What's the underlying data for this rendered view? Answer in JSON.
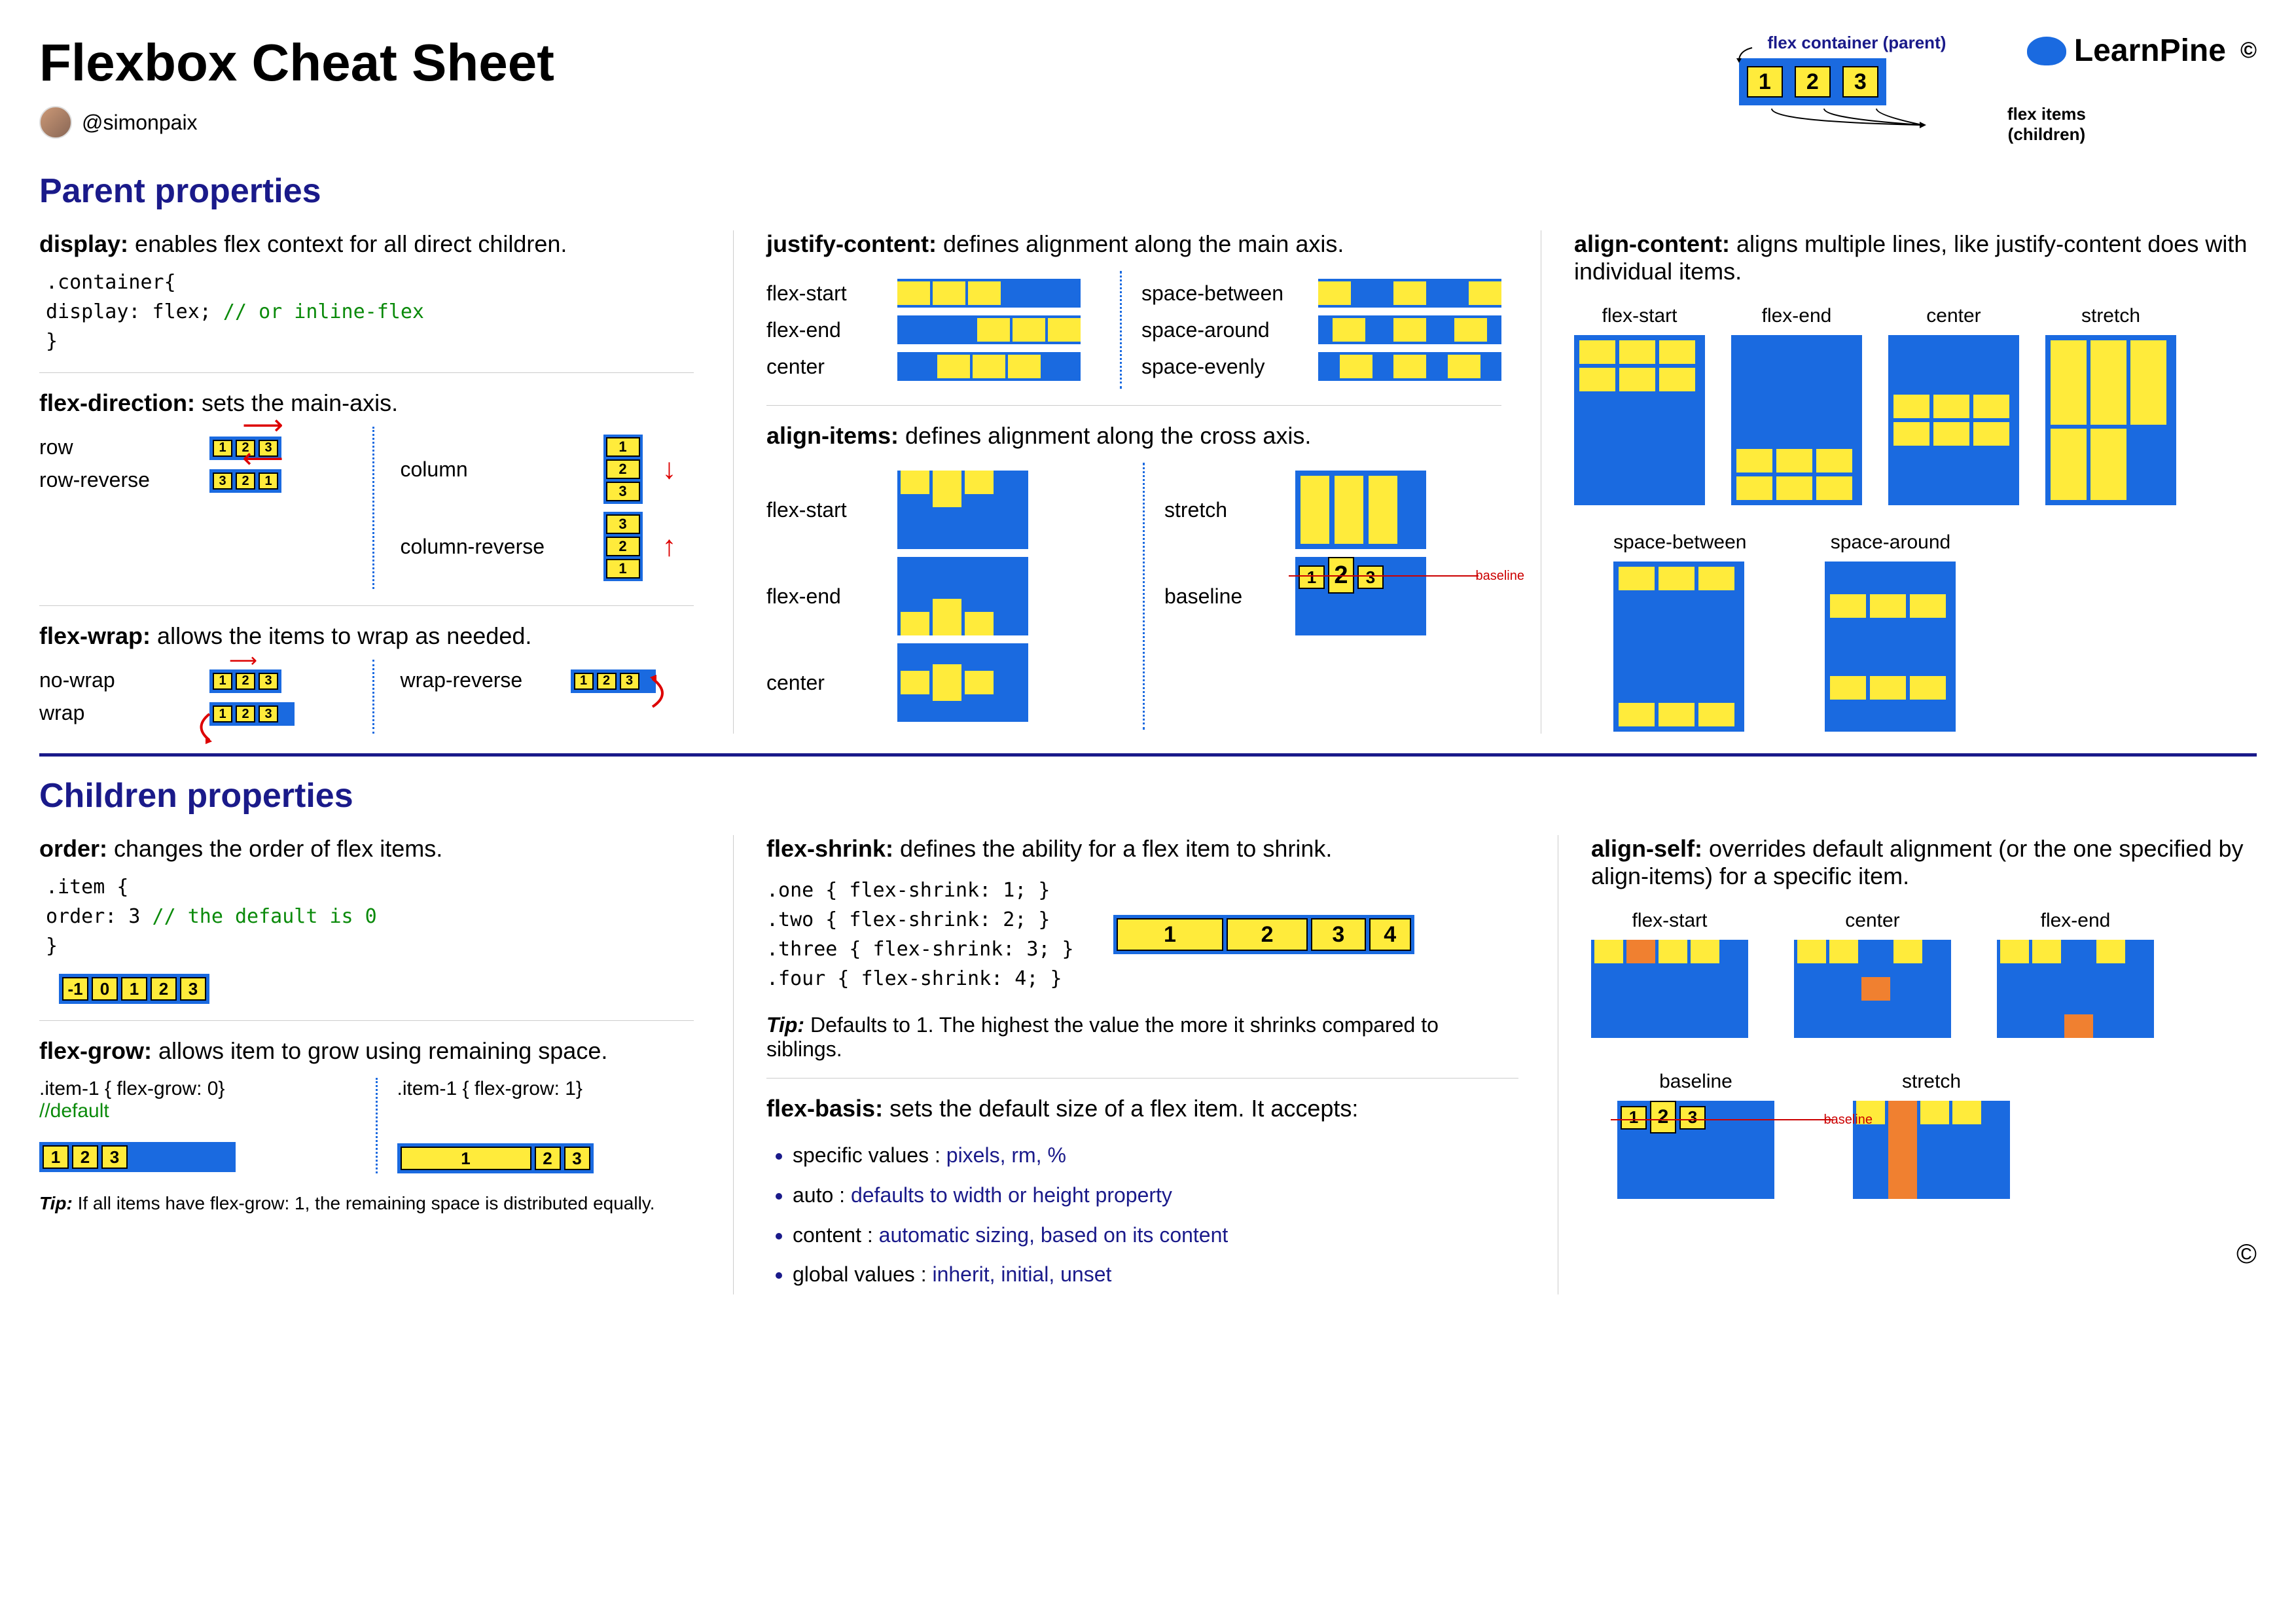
{
  "title": "Flexbox Cheat Sheet",
  "author_handle": "@simonpaix",
  "brand": "LearnPine",
  "copyright": "©",
  "legend": {
    "container_label": "flex container (parent)",
    "items_label_1": "flex items",
    "items_label_2": "(children)",
    "items": [
      "1",
      "2",
      "3"
    ]
  },
  "section_parent": "Parent properties",
  "section_children": "Children properties",
  "display": {
    "name": "display:",
    "desc": " enables flex context for all direct children.",
    "code_open": ".container{",
    "code_prop": "  display: flex;",
    "code_comment": "  // or inline-flex",
    "code_close": "}"
  },
  "flex_direction": {
    "name": "flex-direction:",
    "desc": " sets the main-axis.",
    "row": "row",
    "row_reverse": "row-reverse",
    "column": "column",
    "column_reverse": "column-reverse"
  },
  "flex_wrap": {
    "name": "flex-wrap:",
    "desc": " allows the items to wrap as needed.",
    "no_wrap": "no-wrap",
    "wrap": "wrap",
    "wrap_reverse": "wrap-reverse"
  },
  "justify_content": {
    "name": "justify-content:",
    "desc": " defines alignment along the main axis.",
    "vals": [
      "flex-start",
      "flex-end",
      "center",
      "space-between",
      "space-around",
      "space-evenly"
    ]
  },
  "align_items": {
    "name": "align-items:",
    "desc": " defines alignment along the cross axis.",
    "vals": [
      "flex-start",
      "flex-end",
      "center",
      "stretch",
      "baseline"
    ],
    "baseline_label": "baseline"
  },
  "align_content": {
    "name": "align-content:",
    "desc": " aligns multiple lines, like justify-content does with individual items.",
    "vals": [
      "flex-start",
      "flex-end",
      "center",
      "stretch",
      "space-between",
      "space-around"
    ]
  },
  "order": {
    "name": "order:",
    "desc": " changes the order of flex items.",
    "code_open": ".item {",
    "code_prop": "  order: 3",
    "code_comment": "  // the default is 0",
    "code_close": "}",
    "items": [
      "-1",
      "0",
      "1",
      "2",
      "3"
    ]
  },
  "flex_grow": {
    "name": "flex-grow:",
    "desc": " allows item to grow using remaining space.",
    "ex0": ".item-1 { flex-grow: 0}",
    "ex0_comment": "//default",
    "ex1": ".item-1 { flex-grow: 1}",
    "tip_label": "Tip:",
    "tip_text": " If all items have flex-grow: 1, the remaining space is distributed equally."
  },
  "flex_shrink": {
    "name": "flex-shrink:",
    "desc": " defines the ability for a flex item to shrink.",
    "c1": ".one { flex-shrink: 1; }",
    "c2": ".two { flex-shrink: 2; }",
    "c3": ".three { flex-shrink: 3; }",
    "c4": ".four { flex-shrink: 4; }",
    "items": [
      "1",
      "2",
      "3",
      "4"
    ],
    "tip_label": "Tip:",
    "tip_text": "  Defaults to 1. The highest the value the more it shrinks compared to siblings."
  },
  "flex_basis": {
    "name": "flex-basis:",
    "desc": " sets the default size of a flex item. It accepts:",
    "li1a": "specific values  : ",
    "li1b": "pixels, rm, %",
    "li2a": "auto : ",
    "li2b": "defaults to width or height property",
    "li3a": "content : ",
    "li3b": "automatic sizing, based on its content",
    "li4a": "global values : ",
    "li4b": "inherit, initial, unset"
  },
  "align_self": {
    "name": "align-self:",
    "desc": " overrides default alignment (or the one specified by align-items) for a specific item.",
    "vals": [
      "flex-start",
      "center",
      "flex-end",
      "baseline",
      "stretch"
    ],
    "baseline_label": "baseline"
  }
}
